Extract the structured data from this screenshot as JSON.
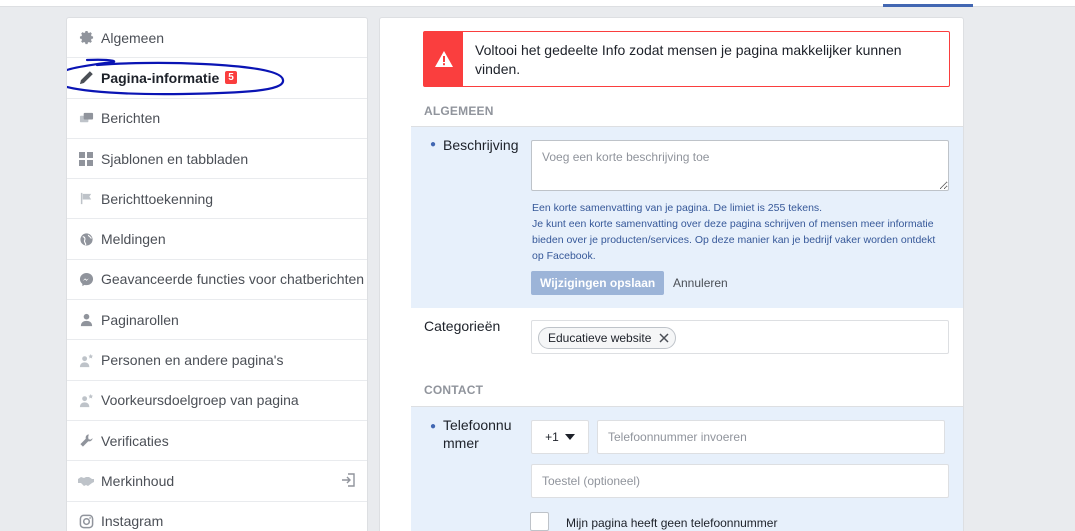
{
  "sidebar": {
    "items": [
      {
        "label": "Algemeen",
        "icon": "gear-icon"
      },
      {
        "label": "Pagina-informatie",
        "icon": "pencil-icon",
        "badge": "5",
        "active": true
      },
      {
        "label": "Berichten",
        "icon": "chat-bubbles-icon"
      },
      {
        "label": "Sjablonen en tabbladen",
        "icon": "grid-icon"
      },
      {
        "label": "Berichttoekenning",
        "icon": "flag-icon"
      },
      {
        "label": "Meldingen",
        "icon": "globe-icon"
      },
      {
        "label": "Geavanceerde functies voor chatberichten",
        "icon": "messenger-icon"
      },
      {
        "label": "Paginarollen",
        "icon": "person-icon"
      },
      {
        "label": "Personen en andere pagina's",
        "icon": "person-star-icon"
      },
      {
        "label": "Voorkeursdoelgroep van pagina",
        "icon": "person-star-icon"
      },
      {
        "label": "Verificaties",
        "icon": "wrench-icon"
      },
      {
        "label": "Merkinhoud",
        "icon": "handshake-icon",
        "extra_icon": "sign-in-icon"
      },
      {
        "label": "Instagram",
        "icon": "instagram-icon"
      }
    ]
  },
  "alert": {
    "text": "Voltooi het gedeelte Info zodat mensen je pagina makkelijker kunnen vinden.",
    "icon": "warning-icon"
  },
  "general": {
    "heading": "ALGEMEEN",
    "description_label": "Beschrijving",
    "description_placeholder": "Voeg een korte beschrijving toe",
    "help_line1": "Een korte samenvatting van je pagina. De limiet is 255 tekens.",
    "help_line2": "Je kunt een korte samenvatting over deze pagina schrijven of mensen meer informatie bieden over je producten/services. Op deze manier kan je bedrijf vaker worden ontdekt op Facebook.",
    "save_label": "Wijzigingen opslaan",
    "cancel_label": "Annuleren",
    "categories_label": "Categorieën",
    "category_chip": "Educatieve website"
  },
  "contact": {
    "heading": "CONTACT",
    "phone_label_line1": "Telefoonnu",
    "phone_label_line2": "mmer",
    "country_code": "+1",
    "phone_placeholder": "Telefoonnummer invoeren",
    "extension_placeholder": "Toestel (optioneel)",
    "no_phone_label": "Mijn pagina heeft geen telefoonnummer"
  },
  "colors": {
    "accent": "#4267b2",
    "alert_red": "#fa3e3e",
    "highlight_bg": "#e7f0fb",
    "annotation_ink": "#0a14b4"
  }
}
